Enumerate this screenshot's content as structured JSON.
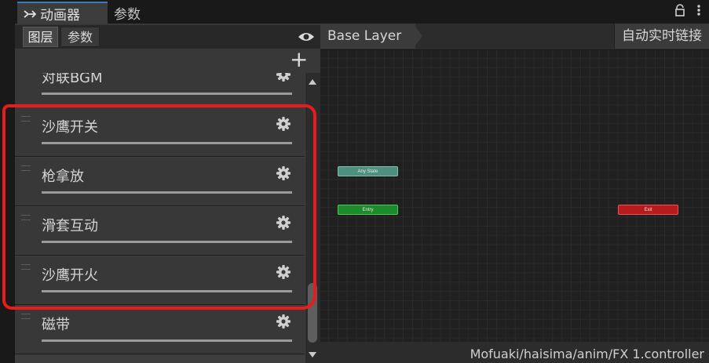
{
  "tabs": {
    "animator_label": "动画器",
    "params_label": "参数"
  },
  "left_panel": {
    "subtabs": {
      "layers": "图层",
      "parameters": "参数"
    },
    "layers": [
      {
        "name": "对联BGM"
      },
      {
        "name": "沙鹰开关"
      },
      {
        "name": "枪拿放"
      },
      {
        "name": "滑套互动"
      },
      {
        "name": "沙鹰开火"
      },
      {
        "name": "磁带"
      }
    ]
  },
  "graph": {
    "breadcrumb": "Base Layer",
    "live_link_label": "自动实时链接",
    "nodes": {
      "any_state": "Any State",
      "entry": "Entry",
      "exit": "Exit"
    },
    "status_path": "Mofuaki/haisima/anim/FX 1.controller"
  },
  "colors": {
    "accent": "#3a79bb",
    "annotation_red": "#e81c1c",
    "any_state": "#4e8f80",
    "entry": "#1e8a2b",
    "exit": "#b81b1b"
  }
}
